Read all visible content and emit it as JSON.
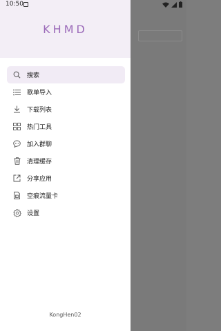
{
  "status_bar": {
    "time": "10:50",
    "icons": [
      "notification-app-icon",
      "wifi-icon",
      "signal-icon",
      "battery-icon"
    ]
  },
  "drawer": {
    "title": "KHMD",
    "footer": "KongHen02",
    "accent_color": "#9b6ab9",
    "header_bg": "#f3eef6",
    "items": [
      {
        "label": "搜索",
        "icon": "search-icon",
        "active": true
      },
      {
        "label": "歌单导入",
        "icon": "list-icon"
      },
      {
        "label": "下载列表",
        "icon": "download-icon"
      },
      {
        "label": "热门工具",
        "icon": "grid-icon"
      },
      {
        "label": "加入群聊",
        "icon": "chat-icon"
      },
      {
        "label": "清理缓存",
        "icon": "trash-icon"
      },
      {
        "label": "分享应用",
        "icon": "share-icon"
      },
      {
        "label": "空痕流量卡",
        "icon": "sim-card-icon"
      },
      {
        "label": "设置",
        "icon": "gear-icon"
      }
    ]
  }
}
